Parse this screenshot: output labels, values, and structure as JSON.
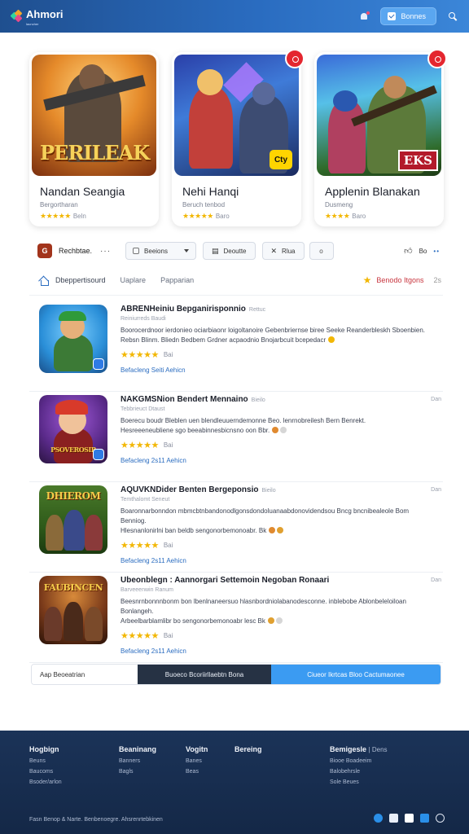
{
  "header": {
    "logo_text": "Ahmori",
    "logo_sub": "launcher",
    "button_label": "Bonnes"
  },
  "featured": [
    {
      "title": "Nandan Seangia",
      "subtitle": "Bergortharan",
      "rating_text": "Beln",
      "caption": "PERILEAK",
      "badge": ""
    },
    {
      "title": "Nehi Hanqi",
      "subtitle": "Beruch tenbod",
      "rating_text": "Baro",
      "caption": "",
      "badge": "Cty"
    },
    {
      "title": "Applenin Blanakan",
      "subtitle": "Dusmeng",
      "rating_text": "Baro",
      "caption": "",
      "badge": "EKS"
    }
  ],
  "filterbar": {
    "app_label": "Rechbtae.",
    "app_icon_letter": "G",
    "more": "···",
    "select_label": "Beeions",
    "button1_label": "Deoutte",
    "button2_label": "Rlua",
    "button3_label": "o",
    "right_label": "Bo",
    "right_dots": "••"
  },
  "tabs": {
    "items": [
      "Dbeppertisourd",
      "Uaplare",
      "Papparian"
    ],
    "right_label": "Benodo Itgons",
    "right_sep": "2s"
  },
  "list": [
    {
      "title": "ABRENHeiniu Bepganirisponnio",
      "tag": "Rettuc",
      "meta": "Reiniurreds     Baudi",
      "desc1": "Boorocerdnoor ierdonieo ociarbiaonr loigoltanoire Gebenbriernse biree Seeke Reanderbleskh Sboenbien.",
      "desc2": "Rebsn Blinm. Bliedn Bedbem Grdner acpaodnio Bnojarbcuit bcepedacr",
      "rating": "Bai",
      "link": "Befacleng Seiti Aehicn",
      "date": "",
      "thumb_title": ""
    },
    {
      "title": "NAKGMSNion Bendert Mennaino",
      "tag": "Bieilo",
      "meta": "Tebbrieuct     Dtaust",
      "desc1": "Boerecu boudr Bleblen uen blendleuuerndemonne Beo. lenrnobreilesh Bern Benrekt.",
      "desc2": "Hesreeeneubliene sgo beeabinnesbicnsno oon Bbr.",
      "rating": "Bai",
      "link": "Befacleng 2s11 Aehicn",
      "date": "Dan",
      "thumb_title": "PSOVEROSIR"
    },
    {
      "title": "AQUVKNDider Benten Bergeponsio",
      "tag": "Bieilo",
      "meta": "Temthalomt     Seneut",
      "desc1": "Boaronnarbonndon mbmcbtnbandonodlgonsdondoluanaabdonovidendsou Bncg bncnibealeole Bom Benniog.",
      "desc2": "Hlesnanlonirlni ban beldb sengonorbemonoabr. Bk",
      "rating": "Bai",
      "link": "Befacleng 2s11 Aehicn",
      "date": "Dan",
      "thumb_title": "DHIEROM"
    },
    {
      "title": "Ubeonblegn : Aannorgari Settemoin Negoban Ronaari",
      "tag": "",
      "meta": "Barveeenwin     Ranum",
      "desc1": "Beesnrnbonnnbonm bon lbenlnaneersuo hlasnbordniolabanodesconne. inblebobe Ablonbeleloiloan Bonlangeh.",
      "desc2": "Arbeelbarblamlibr bo sengonorbemonoabr lesc Bk",
      "rating": "Bai",
      "link": "Befacleng 2s11 Aehicn",
      "date": "Dan",
      "thumb_title": "FAUBINCEN"
    }
  ],
  "actionbar": {
    "input_label": "Aap Beoeatrian",
    "dark_label": "Buoeco Bcoriirllaebtn Bona",
    "blue_label": "Ciueor Ikrtcas Bloo Cactumaonee"
  },
  "footer": {
    "columns": [
      {
        "head": "Hogbign",
        "links": [
          "Beuns",
          "Baucoms",
          "Bsoder/arlon"
        ]
      },
      {
        "head": "Beaninang",
        "links": [
          "Banners",
          "Bagls"
        ]
      },
      {
        "head": "Vogitn",
        "links": [
          "Banes",
          "Beas"
        ]
      },
      {
        "head": "Bereing",
        "links": []
      },
      {
        "head": "Bemigesle",
        "head_extra": "Dens",
        "links": [
          "Biooe Boadeeim",
          "Balobehrsle",
          "Sole Beues"
        ]
      }
    ],
    "copyright": "Fasn Benop & Narte. Benbenoegre. Ahsrenrtebkinen",
    "colors": {
      "accent": "#2a6cc0",
      "footer_bg": "#1b3358"
    }
  }
}
